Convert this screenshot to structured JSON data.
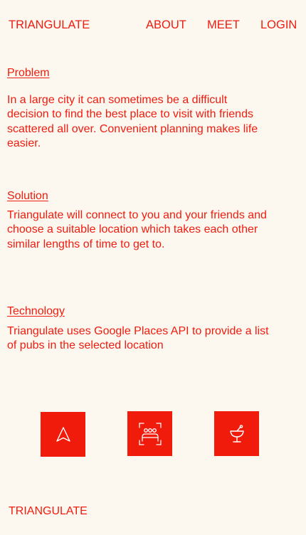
{
  "nav": {
    "brand": "TRIANGULATE",
    "about": "ABOUT",
    "meet": "MEET",
    "login": "LOGIN"
  },
  "sections": {
    "problem": {
      "title": "Problem",
      "text": "In a large city it can sometimes be a difficult decision to find the best place to visit with friends scattered all over. Convenient planning makes life easier."
    },
    "solution": {
      "title": "Solution",
      "text": "Triangulate will connect to you and your friends and choose a suitable location which takes each other similar lengths of time to get to."
    },
    "technology": {
      "title": "Technology",
      "text": "Triangulate uses Google Places API to provide a list of pubs in the selected location"
    }
  },
  "features": {
    "icons": [
      "navigation-arrow-icon",
      "group-of-people-icon",
      "cocktail-glass-icon"
    ],
    "tile_color": "#f01b0b"
  },
  "footer": {
    "brand": "TRIANGULATE"
  },
  "colors": {
    "background": "#fcf8ef",
    "accent": "#ef1c10"
  }
}
